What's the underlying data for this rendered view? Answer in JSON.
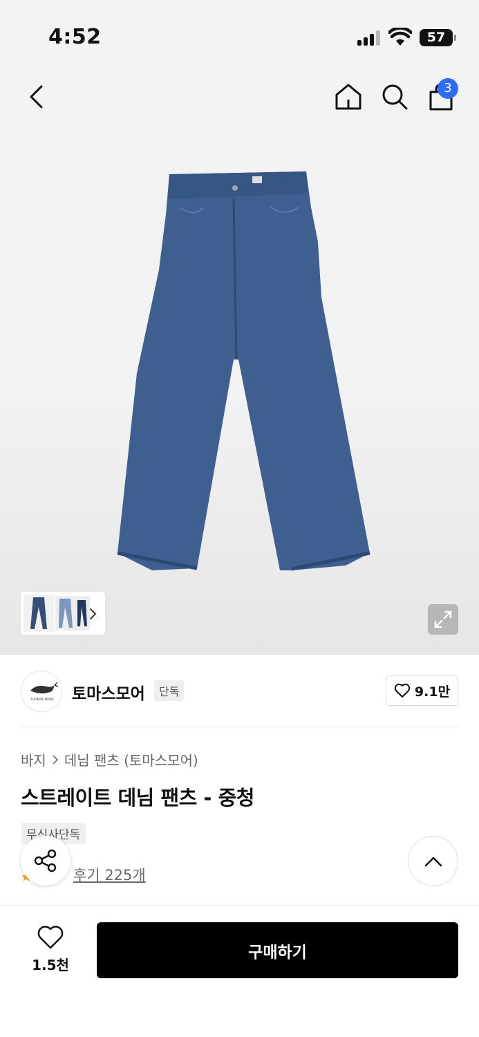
{
  "status_bar": {
    "time": "4:52",
    "battery": "57"
  },
  "nav": {
    "cart_count": "3"
  },
  "brand": {
    "name": "토마스모어",
    "tag": "단독",
    "likes": "9.1만",
    "logo_text": "THOMAS MORE"
  },
  "breadcrumb": {
    "category": "바지",
    "subcategory": "데님 팬츠 (토마스모어)"
  },
  "product": {
    "title": "스트레이트 데님 팬츠 - 중청",
    "badge": "무신사단독",
    "reviews": "후기 225개"
  },
  "bottom_bar": {
    "like_count": "1.5천",
    "buy_label": "구매하기"
  },
  "colors": {
    "accent": "#2f6cf5",
    "denim": "#3e5f8f",
    "buy_button": "#000000"
  },
  "icons": [
    "back-icon",
    "home-icon",
    "search-icon",
    "shopping-bag-icon",
    "expand-icon",
    "heart-icon",
    "share-icon",
    "chevron-up-icon",
    "star-icon"
  ]
}
